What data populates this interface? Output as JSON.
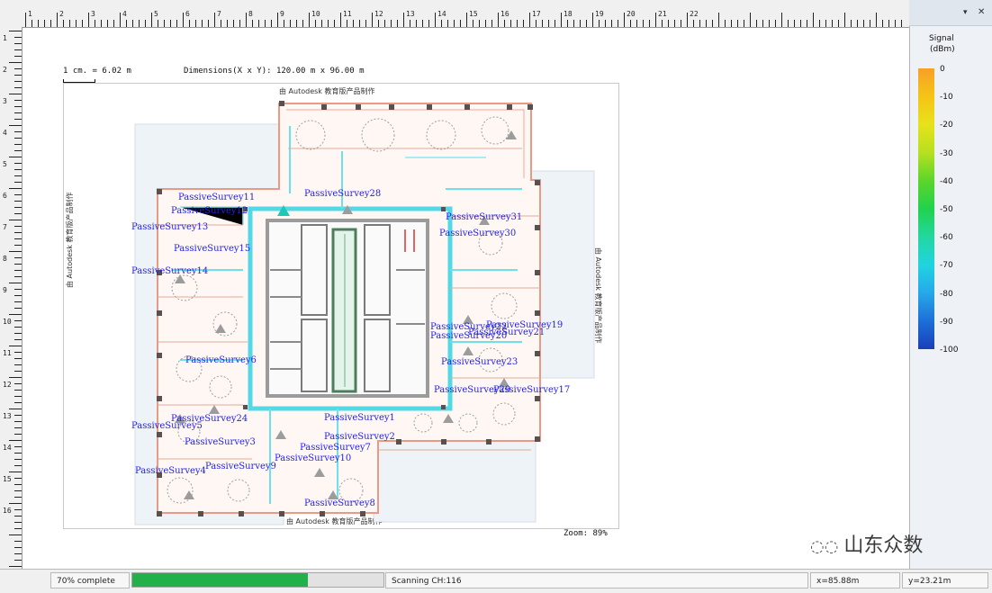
{
  "toolbar": {
    "scale_text": "1 cm. = 6.02 m",
    "dimensions_text": "Dimensions(X x Y): 120.00 m x 96.00 m"
  },
  "ruler": {
    "top_numbers": [
      "1",
      "2",
      "3",
      "4",
      "5",
      "6",
      "7",
      "8",
      "9",
      "10",
      "11",
      "12",
      "13",
      "14",
      "15",
      "16",
      "17",
      "18",
      "19",
      "20",
      "21",
      "22"
    ],
    "left_numbers": [
      "1",
      "2",
      "3",
      "4",
      "5",
      "6",
      "7",
      "8",
      "9",
      "10",
      "11",
      "12",
      "13",
      "14",
      "15",
      "16"
    ]
  },
  "plan": {
    "watermark_top": "由 Autodesk 教育版产品制作",
    "watermark_left": "由 Autodesk 教育版产品制作",
    "watermark_right": "由 Autodesk 教育版产品制作",
    "watermark_bottom": "由 Autodesk 教育版产品制作",
    "zoom_text": "Zoom: 89%",
    "survey_points": [
      "PassiveSurvey11",
      "PassiveSurvey12",
      "PassiveSurvey13",
      "PassiveSurvey15",
      "PassiveSurvey14",
      "PassiveSurvey28",
      "PassiveSurvey31",
      "PassiveSurvey30",
      "PassiveSurvey6",
      "PassiveSurvey23",
      "PassiveSurvey29",
      "PassiveSurvey17",
      "PassiveSurvey5",
      "PassiveSurvey4",
      "PassiveSurvey1",
      "PassiveSurvey2",
      "PassiveSurvey3",
      "PassiveSurvey7",
      "PassiveSurvey8",
      "PassiveSurvey9",
      "PassiveSurvey10",
      "PassiveSurvey22",
      "PassiveSurvey21",
      "PassiveSurvey20",
      "PassiveSurvey24",
      "PassiveSurvey19"
    ]
  },
  "legend": {
    "title_line1": "Signal",
    "title_line2": "(dBm)",
    "ticks": [
      "0",
      "-10",
      "-20",
      "-30",
      "-40",
      "-50",
      "-60",
      "-70",
      "-80",
      "-90",
      "-100"
    ],
    "colors": [
      "#f7a027",
      "#f6c416",
      "#e7e21a",
      "#b6e020",
      "#5cd52a",
      "#21d24d",
      "#23d7a0",
      "#20d4e0",
      "#26a8ea",
      "#1d6fd8",
      "#1840b8"
    ],
    "pin_icon": "pin-icon",
    "close_icon": "close-icon"
  },
  "status": {
    "progress_label": "70% complete",
    "progress_value": 0.7,
    "scan_text": "Scanning CH:116",
    "x_coord": "x=85.88m",
    "y_coord": "y=23.21m"
  },
  "watermark": "山东众数"
}
